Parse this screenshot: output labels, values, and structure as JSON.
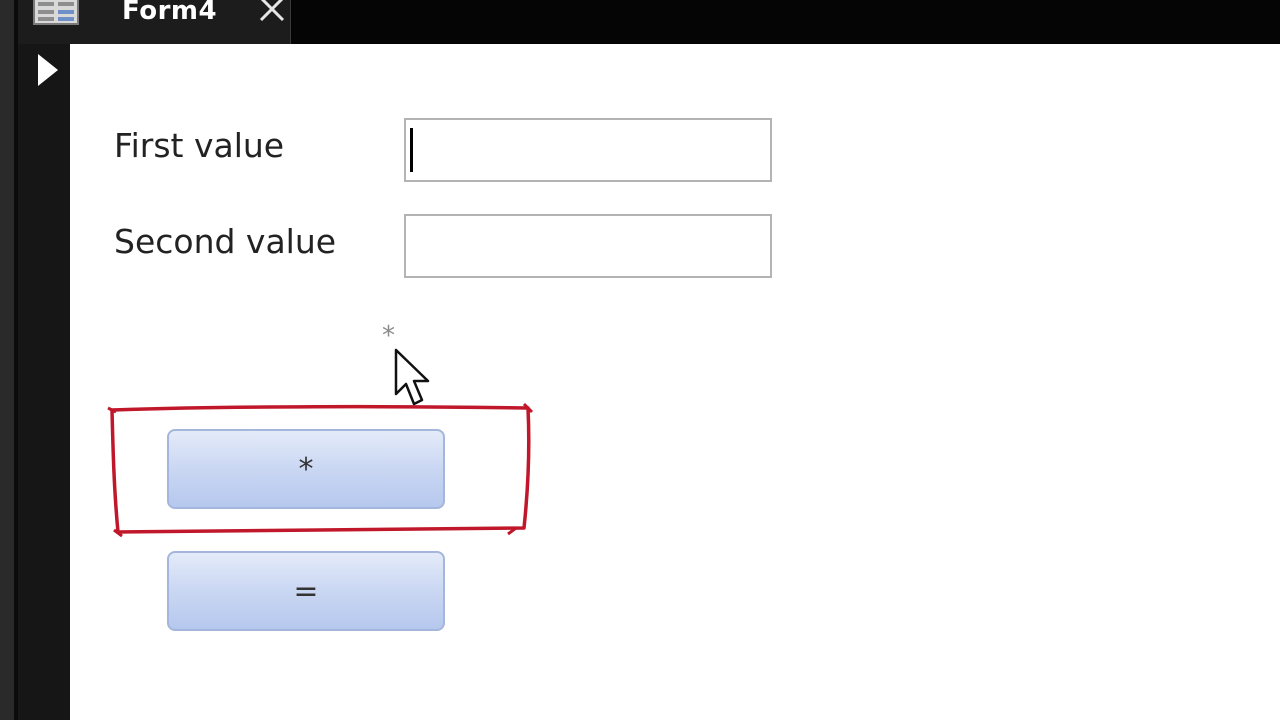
{
  "tab": {
    "title": "Form4",
    "icon": "form-icon",
    "close_icon": "close-icon"
  },
  "record_selector_icon": "triangle-right-icon",
  "form": {
    "first_value": {
      "label": "First value",
      "value": ""
    },
    "second_value": {
      "label": "Second value",
      "value": ""
    },
    "multiply_button": {
      "label": "*",
      "tooltip": "*"
    },
    "equals_button": {
      "label": "="
    }
  },
  "annotation_color": "#c0182a",
  "button_color": "#cad7f3"
}
